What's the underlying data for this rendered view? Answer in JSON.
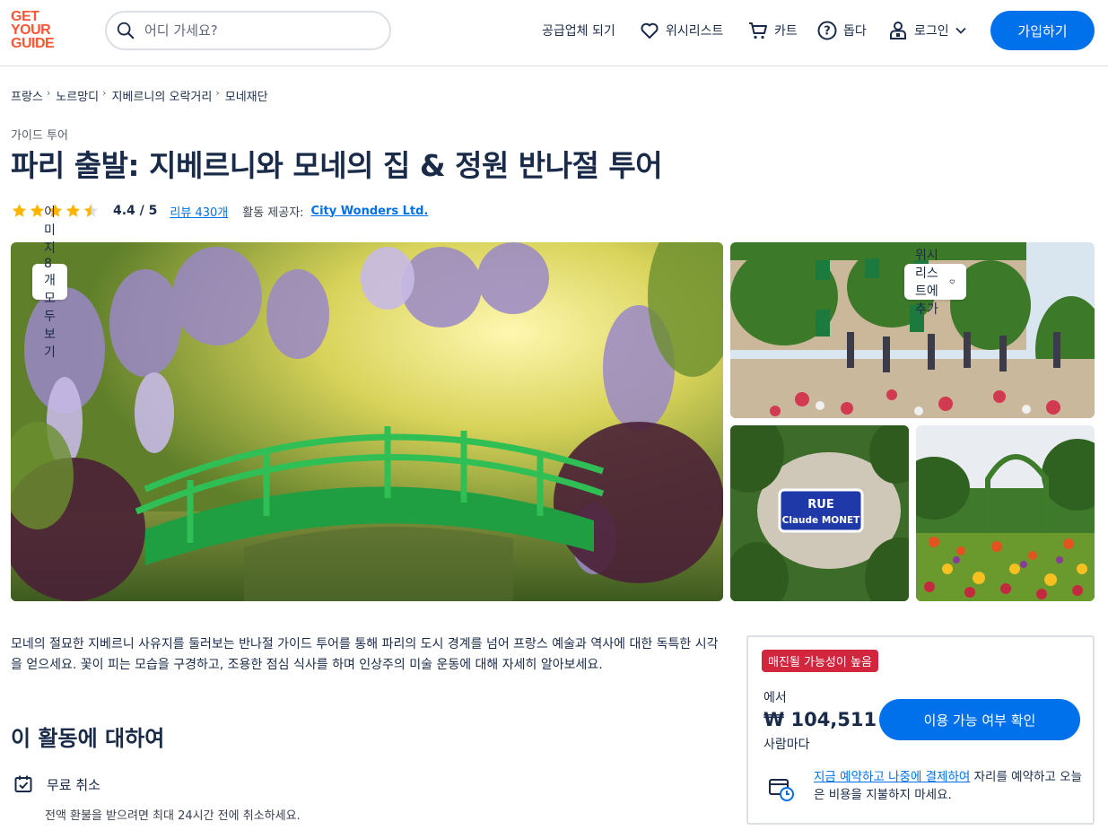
{
  "logo": {
    "line1": "GET",
    "line2": "YOUR",
    "line3": "GUIDE",
    "color": "#ff5533"
  },
  "search": {
    "placeholder": "어디 가세요?",
    "icon": "search-icon"
  },
  "nav": {
    "supplier": "공급업체 되기",
    "wishlist": "위시리스트",
    "cart": "카트",
    "help": "돕다",
    "login": "로그인",
    "signup": "가입하기"
  },
  "breadcrumb": [
    "프랑스",
    "노르망디",
    "지베르니의 오락거리",
    "모네재단"
  ],
  "category": "가이드 투어",
  "title": "파리 출발: 지베르니와 모네의 집 & 정원 반나절 투어",
  "rating": {
    "stars": 4.5,
    "score": "4.4 / 5",
    "reviews": "리뷰 430개",
    "provider_label": "활동 제공자:",
    "provider": "City Wonders Ltd."
  },
  "gallery": {
    "see_all": "이미지 8개 모두 보기",
    "add_wishlist": "위시리스트에 추가",
    "sign_line1": "RUE",
    "sign_line2": "Claude MONET"
  },
  "description": "모네의 절묘한 지베르니 사유지를 둘러보는 반나절 가이드 투어를 통해 파리의 도시 경계를 넘어 프랑스 예술과 역사에 대한 독특한 시각을 얻으세요. 꽃이 피는 모습을 구경하고, 조용한 점심 식사를 하며 인상주의 미술 운동에 대해 자세히 알아보세요.",
  "about": {
    "heading": "이 활동에 대하여",
    "feature_title": "무료 취소",
    "feature_sub": "전액 환불을 받으려면 최대 24시간 전에 취소하세요."
  },
  "booking": {
    "badge": "매진될 가능성이 높음",
    "from": "에서",
    "price": "₩ 104,511",
    "per": "사람마다",
    "check": "이용 가능 여부 확인",
    "reserve_link": "지금 예약하고 나중에 결제하여",
    "reserve_text": " 자리를 예약하고 오늘은 비용을 지불하지 마세요."
  },
  "colors": {
    "accent": "#0071eb",
    "badge": "#d1263d",
    "star": "#ffb400",
    "text": "#1a2b49"
  }
}
